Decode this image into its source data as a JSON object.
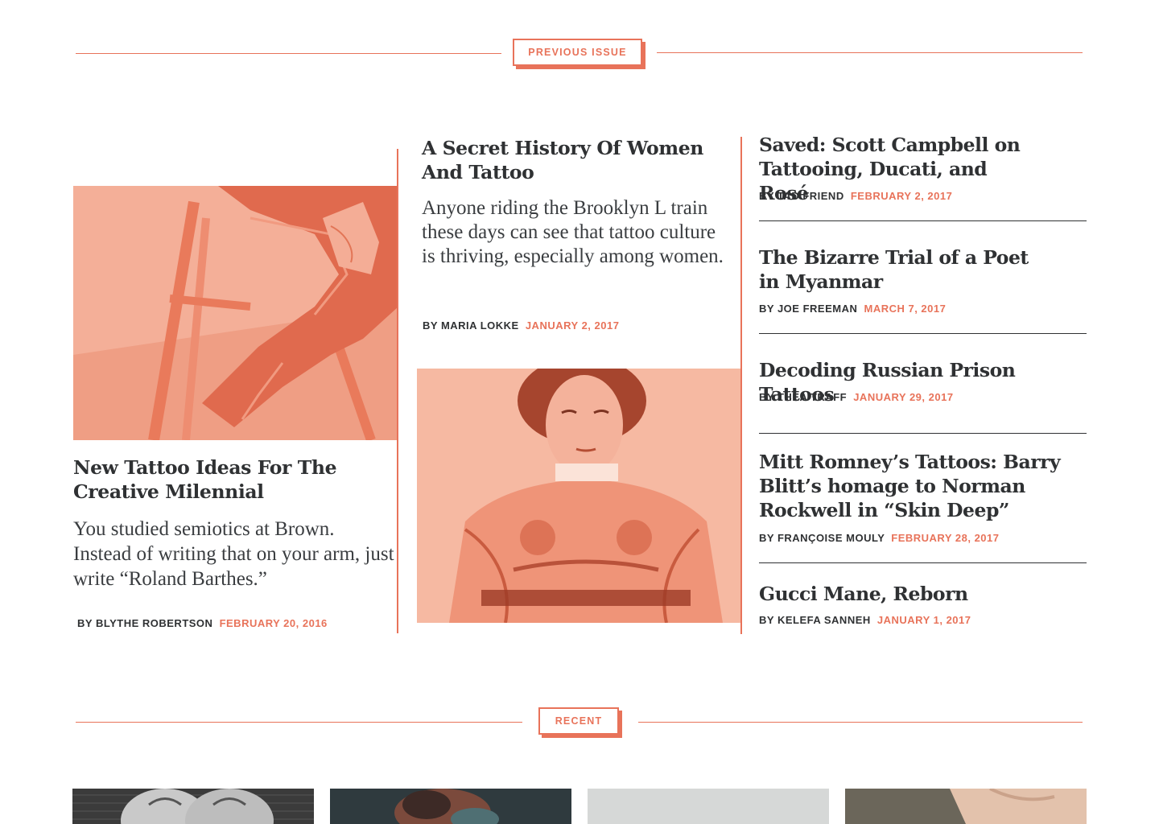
{
  "sections": {
    "previous_issue_label": "Previous Issue",
    "recent_label": "Recent"
  },
  "feature_left": {
    "headline": "New Tattoo Ideas For The Creative Milennial",
    "dek": "You studied semiotics at Brown. Instead of writing that on your arm, just write “Roland Barthes.”",
    "by": "By",
    "author": "Blythe Robertson",
    "date": "February 20, 2016"
  },
  "feature_center": {
    "headline": "A Secret History Of Women And Tattoo",
    "dek": "Anyone riding the Brooklyn L train these days can see that tattoo culture is thriving, especially among women.",
    "by": "By",
    "author": "Maria Lokke",
    "date": "January 2, 2017"
  },
  "sidebar_list": [
    {
      "headline": "Saved: Scott Campbell on Tattooing, Ducati, and Rosé",
      "by": "By",
      "author": "Tad Friend",
      "date": "February 2, 2017"
    },
    {
      "headline": "The Bizarre Trial of a Poet in Myanmar",
      "by": "By",
      "author": "Joe Freeman",
      "date": "March 7, 2017"
    },
    {
      "headline": "Decoding Russian Prison Tattoos",
      "by": "By",
      "author": "Thea Traff",
      "date": "January 29, 2017"
    },
    {
      "headline": "Mitt Romney’s Tattoos: Barry Blitt’s homage to Norman Rockwell in “Skin Deep”",
      "by": "By",
      "author": "Françoise Mouly",
      "date": "February 28, 2017"
    },
    {
      "headline": "Gucci Mane, Reborn",
      "by": "By",
      "author": "Kelefa Sanneh",
      "date": "January 1, 2017"
    }
  ],
  "colors": {
    "accent": "#e8735a",
    "text": "#2f3133",
    "photo_tint": "#f08c71"
  },
  "icons": {
    "left_image": "tattooed-leg-on-stool-photo",
    "center_image": "tattooed-woman-portrait-photo"
  }
}
